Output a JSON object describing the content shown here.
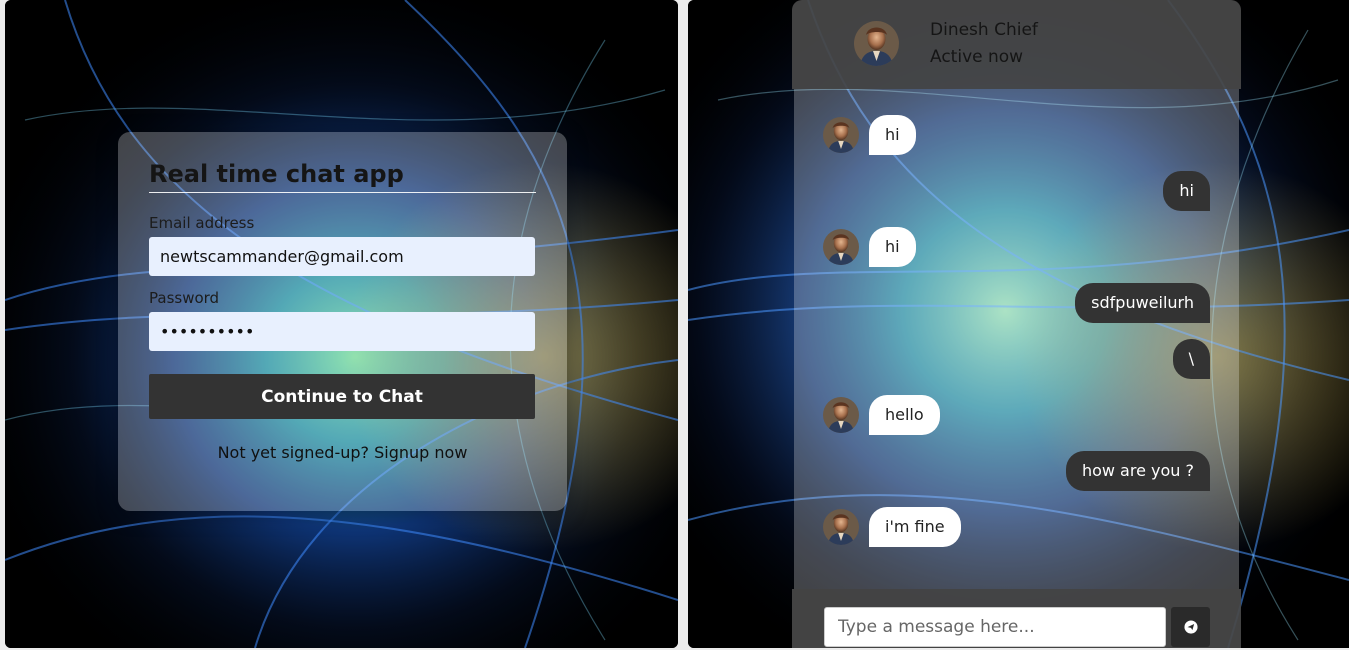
{
  "login": {
    "title": "Real time chat app",
    "email_label": "Email address",
    "email_value": "newtscammander@gmail.com",
    "password_label": "Password",
    "password_value": "••••••••••",
    "continue_label": "Continue to Chat",
    "signup_prompt": "Not yet signed-up?",
    "signup_link": "Signup now"
  },
  "chat": {
    "contact_name": "Dinesh Chief",
    "contact_status": "Active now",
    "messages": [
      {
        "dir": "in",
        "text": "hi"
      },
      {
        "dir": "out",
        "text": "hi"
      },
      {
        "dir": "in",
        "text": "hi"
      },
      {
        "dir": "out",
        "text": "sdfpuweilurh"
      },
      {
        "dir": "out",
        "text": "\\"
      },
      {
        "dir": "in",
        "text": "hello"
      },
      {
        "dir": "out",
        "text": "how are you ?"
      },
      {
        "dir": "in",
        "text": "i'm fine"
      }
    ],
    "input_placeholder": "Type a message here..."
  },
  "icons": {
    "send": "send-icon",
    "avatar": "avatar"
  }
}
